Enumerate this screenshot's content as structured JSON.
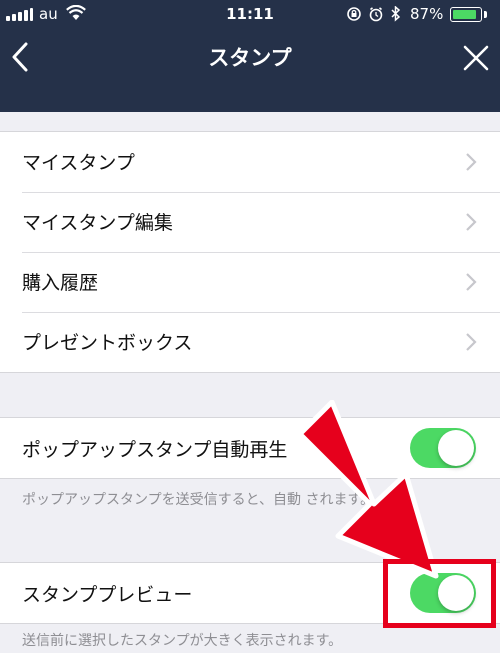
{
  "status_bar": {
    "carrier": "au",
    "time": "11:11",
    "battery_percent": "87%",
    "battery_level": 0.87,
    "icons": [
      "signal-icon",
      "wifi-icon",
      "rotation-lock-icon",
      "alarm-icon",
      "bluetooth-icon",
      "battery-icon"
    ]
  },
  "nav": {
    "title": "スタンプ",
    "back_icon": "chevron-left-icon",
    "close_icon": "close-icon"
  },
  "menu_items": [
    {
      "label": "マイスタンプ"
    },
    {
      "label": "マイスタンプ編集"
    },
    {
      "label": "購入履歴"
    },
    {
      "label": "プレゼントボックス"
    }
  ],
  "settings": {
    "popup_autoplay": {
      "label": "ポップアップスタンプ自動再生",
      "enabled": true,
      "description": "ポップアップスタンプを送受信すると、自動 されます。"
    },
    "preview": {
      "label": "スタンププレビュー",
      "enabled": true,
      "description": "送信前に選択したスタンプが大きく表示されます。"
    }
  },
  "colors": {
    "nav_background": "#253149",
    "toggle_on": "#4cd964",
    "annotation_red": "#e6001c",
    "page_background": "#efeff4"
  }
}
